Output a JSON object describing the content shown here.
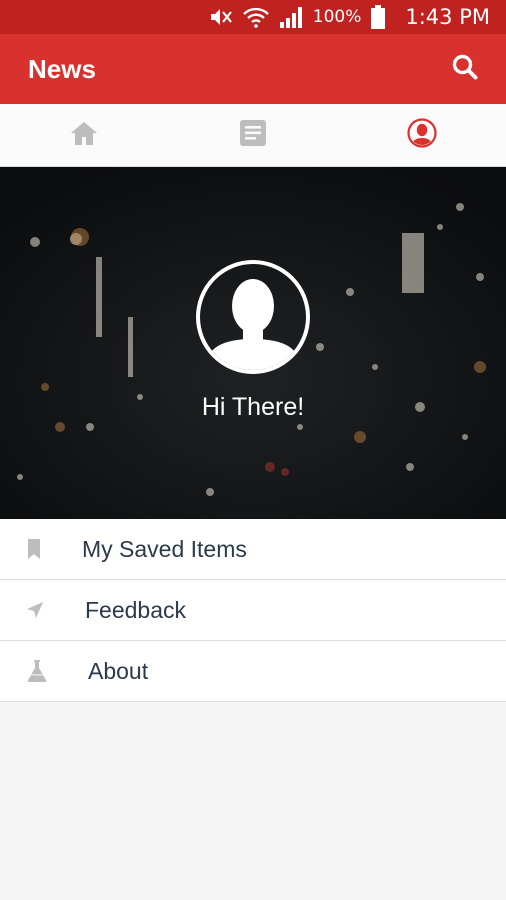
{
  "status_bar": {
    "battery": "100%",
    "time": "1:43 PM"
  },
  "app_bar": {
    "title": "News"
  },
  "tabs": [
    {
      "name": "home",
      "icon": "home-icon",
      "active": false
    },
    {
      "name": "articles",
      "icon": "article-icon",
      "active": false
    },
    {
      "name": "profile",
      "icon": "profile-icon",
      "active": true
    }
  ],
  "hero": {
    "greeting": "Hi There!"
  },
  "menu": {
    "items": [
      {
        "label": "My Saved Items",
        "icon": "bookmark-icon"
      },
      {
        "label": "Feedback",
        "icon": "send-icon"
      },
      {
        "label": "About",
        "icon": "flask-icon"
      }
    ]
  },
  "colors": {
    "status_bar": "#c0221f",
    "app_bar": "#d9312d",
    "accent": "#d9312d",
    "inactive_icon": "#bdbdbd",
    "menu_text": "#2b3a4a"
  }
}
